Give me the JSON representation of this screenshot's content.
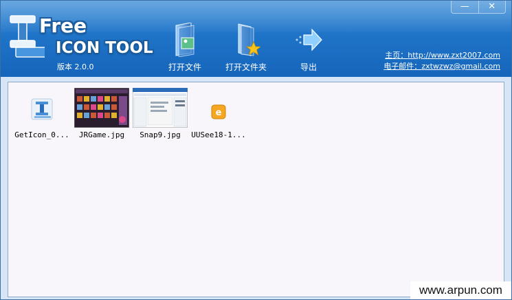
{
  "window": {
    "minimize_glyph": "—",
    "close_glyph": "✕"
  },
  "logo": {
    "free": "Free",
    "tool": "ICON TOOL",
    "version": "版本 2.0.0"
  },
  "toolbar": {
    "open_file": "打开文件",
    "open_folder": "打开文件夹",
    "export": "导出"
  },
  "links": {
    "homepage_label": "主页：",
    "homepage_url": "http://www.zxt2007.com",
    "email_label": "电子邮件：",
    "email": "zxtwzwz@gmail.com"
  },
  "files": [
    {
      "name": "GetIcon_0...",
      "icon": "app-icon"
    },
    {
      "name": "JRGame.jpg",
      "icon": "image-thumbnail"
    },
    {
      "name": "Snap9.jpg",
      "icon": "image-thumbnail"
    },
    {
      "name": "UUSee18-1...",
      "icon": "uusee-icon"
    }
  ],
  "watermark": "www.arpun.com"
}
